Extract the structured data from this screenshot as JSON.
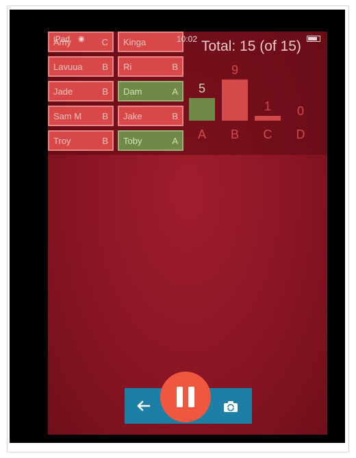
{
  "status_bar": {
    "carrier": "iPad",
    "time": "10:02",
    "wifi_icon": "wifi-icon",
    "battery_icon": "battery-icon"
  },
  "students": [
    {
      "name": "Amy",
      "grade": "C"
    },
    {
      "name": "Kinga",
      "grade": ""
    },
    {
      "name": "Lavuua",
      "grade": "B"
    },
    {
      "name": "Ri",
      "grade": "B"
    },
    {
      "name": "Jade",
      "grade": "B"
    },
    {
      "name": "Dam",
      "grade": "A"
    },
    {
      "name": "Sam M",
      "grade": "B"
    },
    {
      "name": "Jake",
      "grade": "B"
    },
    {
      "name": "Troy",
      "grade": "B"
    },
    {
      "name": "Toby",
      "grade": "A"
    }
  ],
  "summary": {
    "total_label": "Total: 15 (of 15)"
  },
  "chart_data": {
    "type": "bar",
    "categories": [
      "A",
      "B",
      "C",
      "D"
    ],
    "values": [
      5,
      9,
      1,
      0
    ],
    "ylim": [
      0,
      9
    ],
    "colors": {
      "A": "#6e8a46",
      "B": "#d44a4a",
      "C": "#d44a4a",
      "D": "#d44a4a"
    }
  },
  "controls": {
    "back_icon": "arrow-left-icon",
    "pause_icon": "pause-icon",
    "camera_icon": "camera-switch-icon"
  },
  "colors": {
    "accent_bar": "#1e7fa6",
    "pause": "#f0573f",
    "screen": "#8a1524"
  }
}
